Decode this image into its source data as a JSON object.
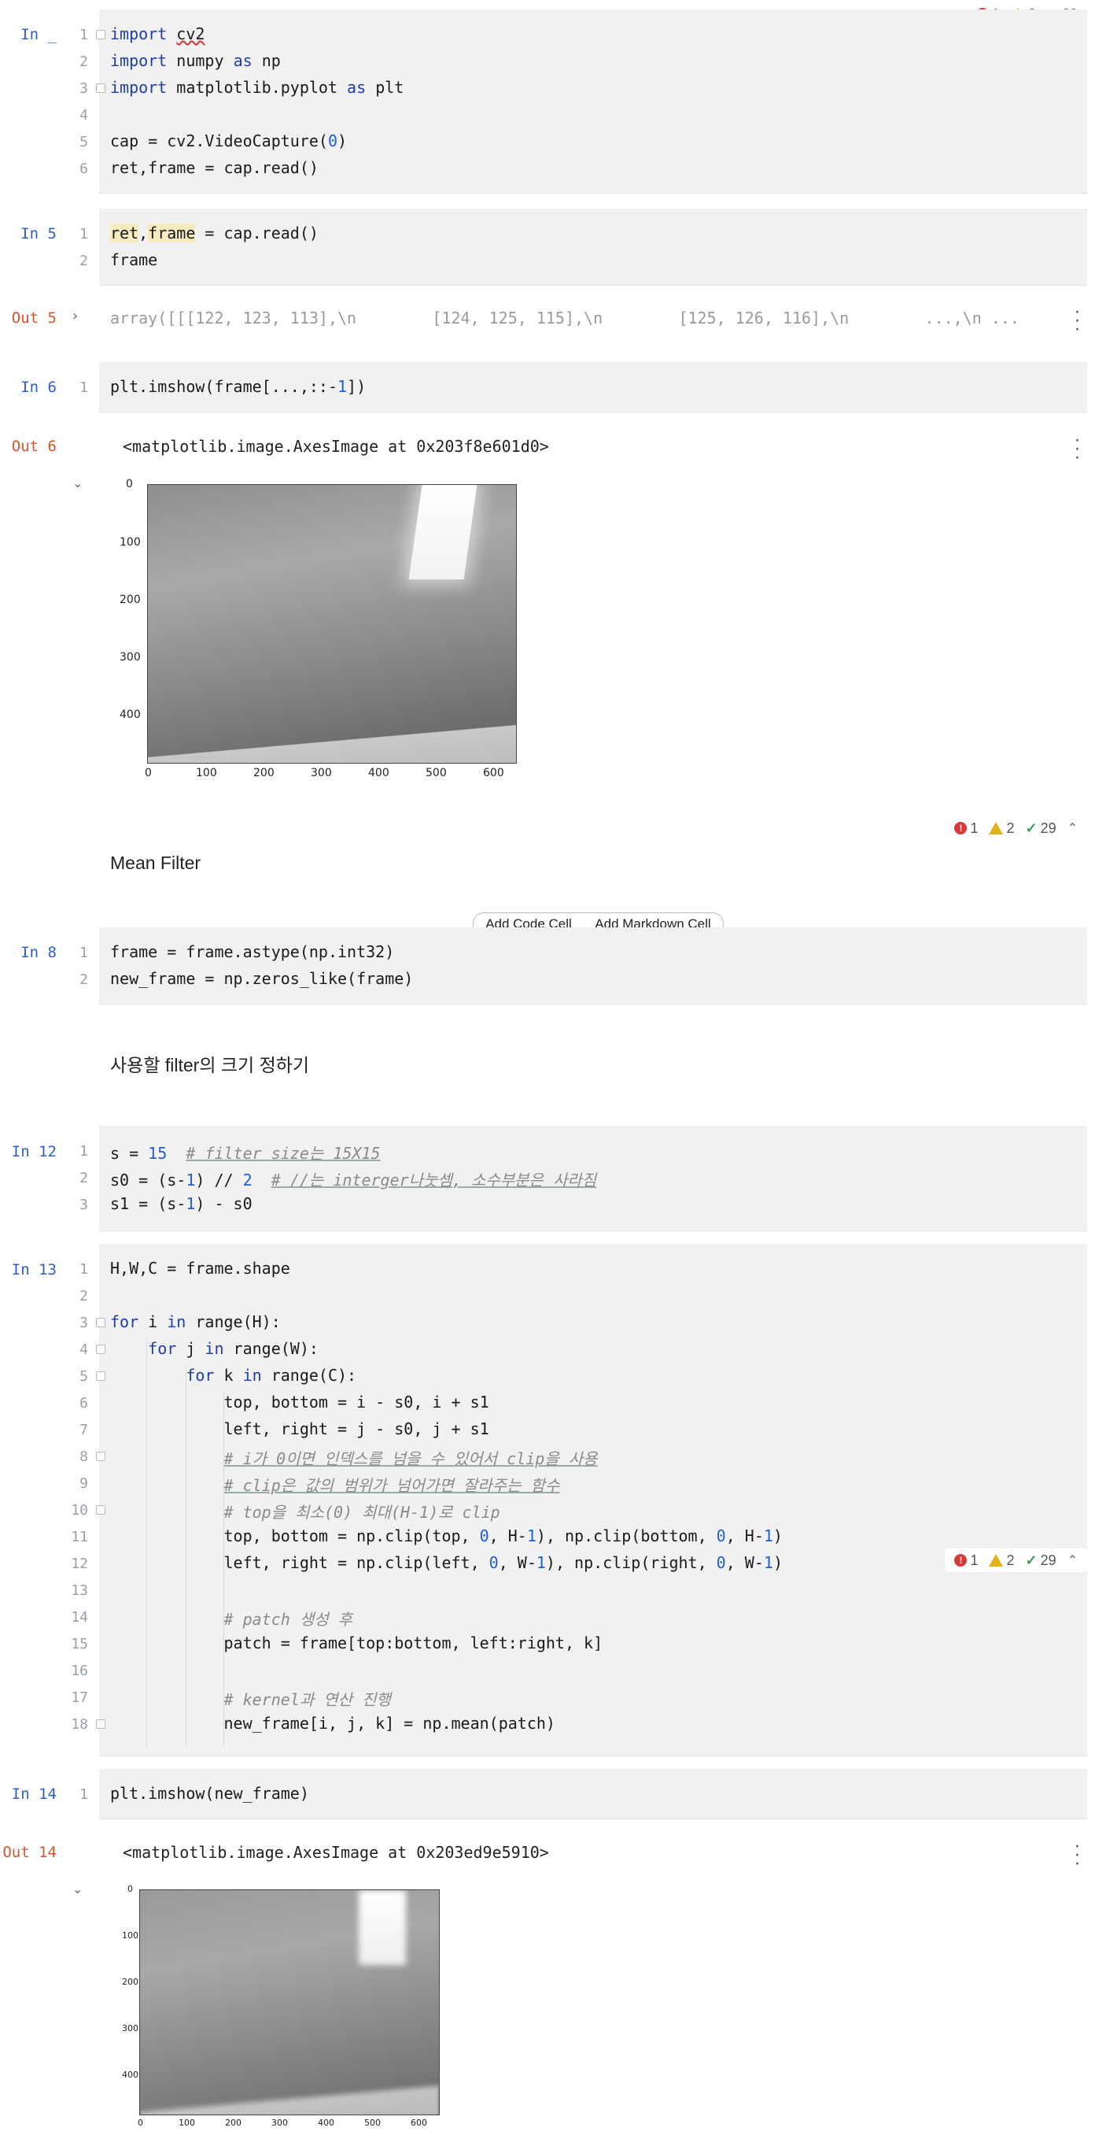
{
  "cells": {
    "c1": {
      "prompt": "In _",
      "lines": [
        "1",
        "2",
        "3",
        "4",
        "5",
        "6"
      ],
      "code": [
        "import",
        "cv2",
        "import",
        "numpy",
        "as",
        "np",
        "import",
        "matplotlib.pyplot",
        "as",
        "plt",
        "cap = cv2.VideoCapture(",
        "0",
        ")",
        "ret,frame = cap.read()"
      ]
    },
    "c2": {
      "prompt": "In 5",
      "lines": [
        "1",
        "2"
      ],
      "code": [
        "ret",
        ",",
        "frame",
        " = cap.read()",
        "frame"
      ]
    },
    "out5": {
      "prompt": "Out 5",
      "text": "array([[[122, 123, 113],\\n        [124, 125, 115],\\n        [125, 126, 116],\\n        ...,\\n ..."
    },
    "c3": {
      "prompt": "In 6",
      "lines": [
        "1"
      ],
      "code": [
        "plt.imshow(frame[...,::-",
        "1",
        "])"
      ]
    },
    "out6": {
      "prompt": "Out 6",
      "text": "<matplotlib.image.AxesImage at 0x203f8e601d0>",
      "yticks": [
        "0",
        "100",
        "200",
        "300",
        "400"
      ],
      "xticks": [
        "0",
        "100",
        "200",
        "300",
        "400",
        "500",
        "600"
      ]
    },
    "md1": {
      "text": "Mean Filter"
    },
    "toolbar": {
      "add_code": "Add Code Cell",
      "add_markdown": "Add Markdown Cell"
    },
    "c4": {
      "prompt": "In 8",
      "lines": [
        "1",
        "2"
      ],
      "code": [
        "frame = frame.astype(np.int32)",
        "new_frame = np.zeros_like(frame)"
      ]
    },
    "md2": {
      "text": "사용할 filter의 크기 정하기"
    },
    "c5": {
      "prompt": "In 12",
      "lines": [
        "1",
        "2",
        "3"
      ],
      "code": [
        "s = ",
        "15",
        "# filter size는 15X15",
        "s0 = (s-",
        "1",
        ") // ",
        "2",
        "# //는 interger나눗셈, 소수부분은 사라짐",
        "s1 = (s-",
        "1",
        ") - s0"
      ]
    },
    "c6": {
      "prompt": "In 13",
      "lines": [
        "1",
        "2",
        "3",
        "4",
        "5",
        "6",
        "7",
        "8",
        "9",
        "10",
        "11",
        "12",
        "13",
        "14",
        "15",
        "16",
        "17",
        "18"
      ],
      "code": [
        "H,W,C = frame.shape",
        "for",
        " i ",
        "in",
        " range(H):",
        "for",
        " j ",
        "in",
        " range(W):",
        "for",
        " k ",
        "in",
        " range(C):",
        "top, bottom = i - s0, i + s1",
        "left, right = j - s0, j + s1",
        "# i가 0이면 인덱스를 넘을 수 있어서 clip을 사용",
        "# clip은 값의 범위가 넘어가면 잘라주는 함수",
        "# top을 최소(0) 최대(H-1)로 clip",
        "top, bottom = np.clip(top, ",
        "0",
        ", H-",
        "1",
        "), np.clip(bottom, ",
        "0",
        ", H-",
        "1",
        ")",
        "left, right = np.clip(left, ",
        "0",
        ", W-",
        "1",
        "), np.clip(right, ",
        "0",
        ", W-",
        "1",
        ")",
        "# patch 생성 후",
        "patch = frame[top:bottom, left:right, k]",
        "# kernel과 연산 진행",
        "new_frame[i, j, k] = np.mean(patch)"
      ]
    },
    "c7": {
      "prompt": "In 14",
      "lines": [
        "1"
      ],
      "code": [
        "plt.imshow(new_frame)"
      ]
    },
    "out14": {
      "prompt": "Out 14",
      "text": "<matplotlib.image.AxesImage at 0x203ed9e5910>",
      "yticks": [
        "0",
        "100",
        "200",
        "300",
        "400"
      ],
      "xticks": [
        "0",
        "100",
        "200",
        "300",
        "400",
        "500",
        "600"
      ]
    }
  },
  "inspections": {
    "errors": "1",
    "warnings": "2",
    "weak": "29"
  },
  "icons": {
    "error": "error-icon",
    "warning": "warning-icon",
    "weak_warning": "weak-warning-icon",
    "collapse": "chevron-up-icon",
    "expand": "chevron-right-icon",
    "more": "more-vertical-icon"
  },
  "colors": {
    "keyword": "#1f3da8",
    "number": "#1f5fd6",
    "comment": "#8a8a8a",
    "in_prompt": "#2f5fc4",
    "out_prompt": "#d9532c"
  }
}
